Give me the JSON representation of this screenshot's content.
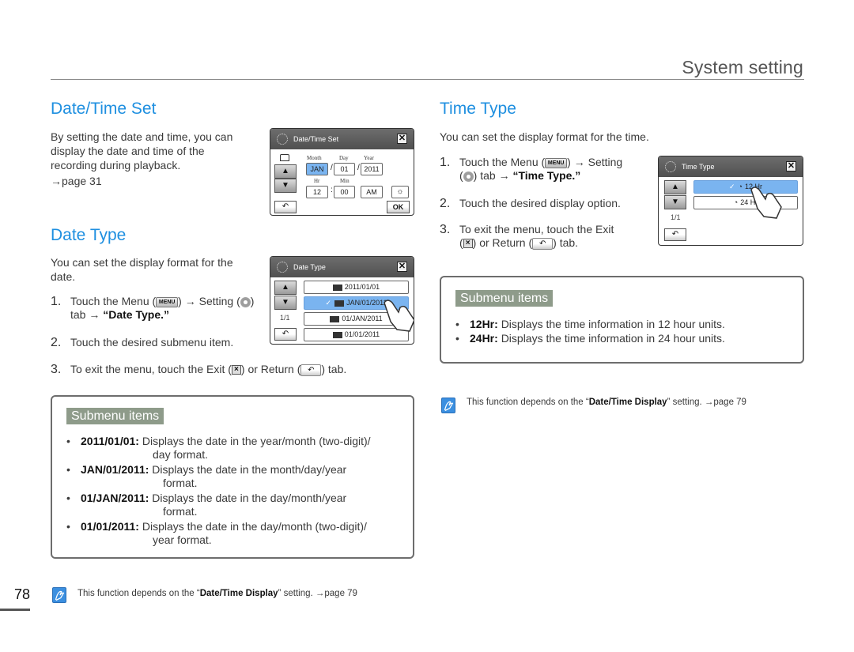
{
  "header": {
    "title": "System setting"
  },
  "page_number": "78",
  "date_time_set": {
    "title": "Date/Time Set",
    "description": "By setting the date and time, you can display the date and time of the recording during playback.",
    "page_ref": "→page 31",
    "screen": {
      "title": "Date/Time Set",
      "labels": {
        "month": "Month",
        "day": "Day",
        "year": "Year",
        "hr": "Hr",
        "min": "Min"
      },
      "values": {
        "month": "JAN",
        "day": "01",
        "year": "2011",
        "hr": "12",
        "min": "00",
        "ampm": "AM"
      },
      "ok_label": "OK",
      "up_icon": "▲",
      "down_icon": "▼",
      "return_icon": "↶",
      "exit_icon": "✕"
    }
  },
  "date_type": {
    "title": "Date Type",
    "description": "You can set the display format for the date.",
    "steps": [
      {
        "num": "1.",
        "pre": "Touch the Menu (",
        "menu_label": "MENU",
        "mid": ") → Setting (",
        "post": ") tab → ",
        "bold": "“Date Type.”"
      },
      {
        "num": "2.",
        "text": "Touch the desired submenu item."
      },
      {
        "num": "3.",
        "pre": "To exit the menu, touch the Exit (",
        "mid": ") or Return (",
        "post": ") tab."
      }
    ],
    "screen": {
      "title": "Date Type",
      "page_indicator": "1/1",
      "options": [
        {
          "label": "2011/01/01",
          "selected": false
        },
        {
          "label": "JAN/01/2011",
          "selected": true
        },
        {
          "label": "01/JAN/2011",
          "selected": false
        },
        {
          "label": "01/01/2011",
          "selected": false
        }
      ],
      "check_icon": "✓"
    },
    "submenu": {
      "title": "Submenu items",
      "items": [
        {
          "key": "2011/01/01:",
          "desc": "Displays the date in the year/month (two-digit)/",
          "desc2": "day format."
        },
        {
          "key": "JAN/01/2011:",
          "desc": "Displays the date in the month/day/year",
          "desc2": "format."
        },
        {
          "key": "01/JAN/2011:",
          "desc": "Displays the date in the day/month/year",
          "desc2": "format."
        },
        {
          "key": "01/01/2011:",
          "desc": "Displays the date in the day/month (two-digit)/",
          "desc2": "year format."
        }
      ]
    },
    "note": {
      "pre": "This function depends on the “",
      "bold": "Date/Time Display",
      "post": "” setting. →page 79"
    }
  },
  "time_type": {
    "title": "Time Type",
    "description": "You can set the display format for the time.",
    "steps": [
      {
        "num": "1.",
        "pre": "Touch the Menu (",
        "menu_label": "MENU",
        "mid": ") → Setting",
        "post": ") tab → ",
        "bold": "“Time Type.”"
      },
      {
        "num": "2.",
        "text": "Touch the desired display option."
      },
      {
        "num": "3.",
        "pre": "To exit the menu, touch the Exit",
        "mid": ") or Return (",
        "post": ") tab."
      }
    ],
    "screen": {
      "title": "Time Type",
      "page_indicator": "1/1",
      "options": [
        {
          "label": "12 Hr",
          "selected": true
        },
        {
          "label": "24 Hr",
          "selected": false
        }
      ]
    },
    "submenu": {
      "title": "Submenu items",
      "items": [
        {
          "key": "12Hr:",
          "desc": "Displays the time information in 12 hour units."
        },
        {
          "key": "24Hr:",
          "desc": "Displays the time information in 24 hour units."
        }
      ]
    },
    "note": {
      "pre": "This function depends on the “",
      "bold": "Date/Time Display",
      "post": "” setting. →page 79"
    }
  },
  "colors": {
    "accent_blue": "#1e8fe0",
    "submenu_title_bg": "#8e9b8a",
    "selected_option": "#7ab4f0"
  }
}
